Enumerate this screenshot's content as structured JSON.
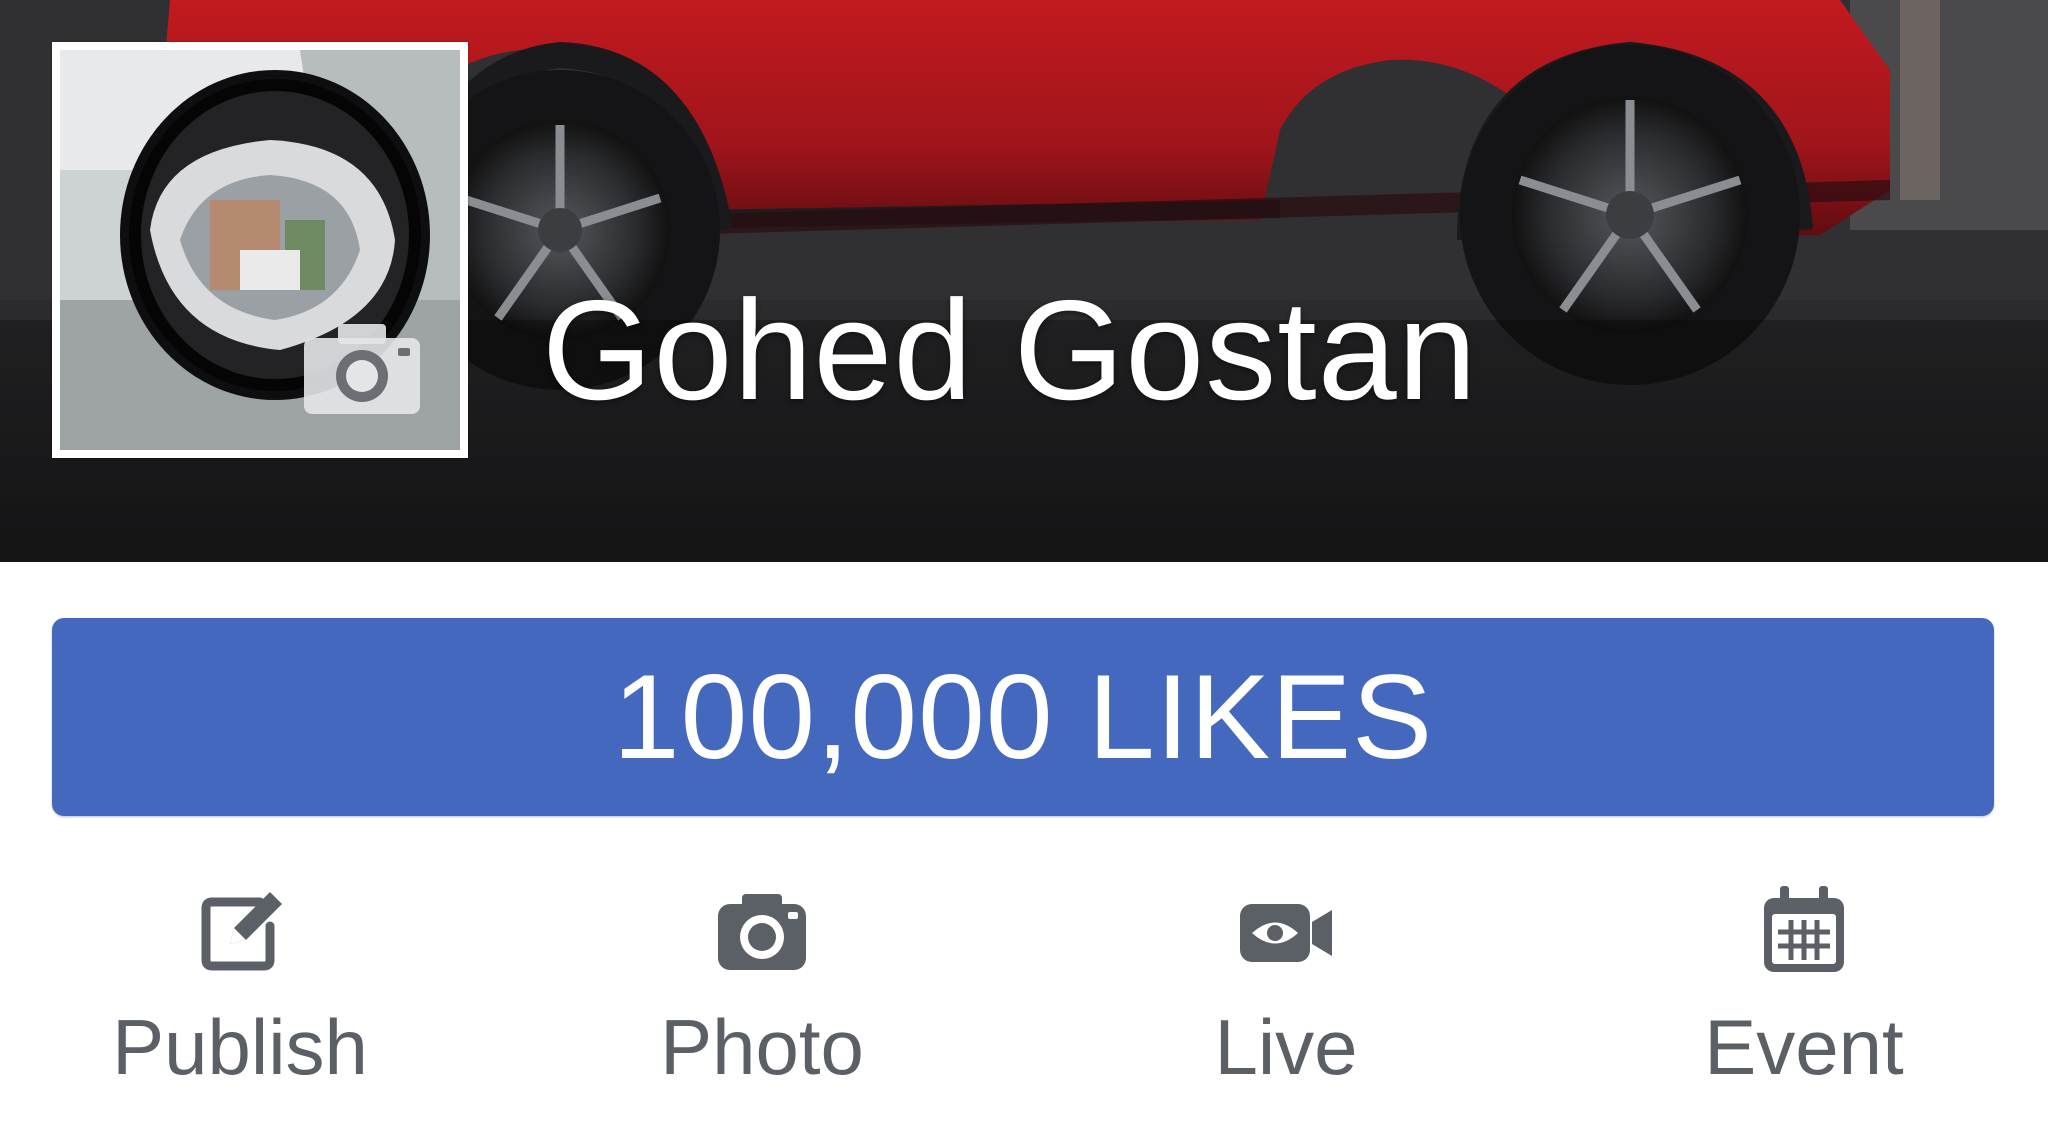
{
  "profile": {
    "name": "Gohed Gostan"
  },
  "likes": {
    "label": "100,000 LIKES"
  },
  "actions": [
    {
      "label": "Publish",
      "icon": "edit-icon"
    },
    {
      "label": "Photo",
      "icon": "camera-icon"
    },
    {
      "label": "Live",
      "icon": "live-video-icon"
    },
    {
      "label": "Event",
      "icon": "calendar-icon"
    }
  ],
  "colors": {
    "likes_button": "#4368bd",
    "action_icon": "#5b5f66",
    "action_label": "#5b5f66",
    "name_text": "#ffffff"
  }
}
